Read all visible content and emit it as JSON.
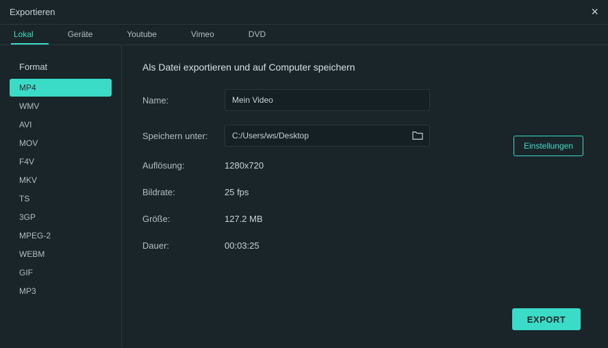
{
  "window": {
    "title": "Exportieren"
  },
  "tabs": [
    {
      "label": "Lokal",
      "active": true
    },
    {
      "label": "Geräte",
      "active": false
    },
    {
      "label": "Youtube",
      "active": false
    },
    {
      "label": "Vimeo",
      "active": false
    },
    {
      "label": "DVD",
      "active": false
    }
  ],
  "sidebar": {
    "title": "Format",
    "items": [
      {
        "label": "MP4",
        "selected": true
      },
      {
        "label": "WMV",
        "selected": false
      },
      {
        "label": "AVI",
        "selected": false
      },
      {
        "label": "MOV",
        "selected": false
      },
      {
        "label": "F4V",
        "selected": false
      },
      {
        "label": "MKV",
        "selected": false
      },
      {
        "label": "TS",
        "selected": false
      },
      {
        "label": "3GP",
        "selected": false
      },
      {
        "label": "MPEG-2",
        "selected": false
      },
      {
        "label": "WEBM",
        "selected": false
      },
      {
        "label": "GIF",
        "selected": false
      },
      {
        "label": "MP3",
        "selected": false
      }
    ]
  },
  "main": {
    "heading": "Als Datei exportieren und auf Computer speichern",
    "name_label": "Name:",
    "name_value": "Mein Video",
    "path_label": "Speichern unter:",
    "path_value": "C:/Users/ws/Desktop",
    "resolution_label": "Auflösung:",
    "resolution_value": "1280x720",
    "settings_label": "Einstellungen",
    "fps_label": "Bildrate:",
    "fps_value": "25 fps",
    "size_label": "Größe:",
    "size_value": "127.2 MB",
    "duration_label": "Dauer:",
    "duration_value": "00:03:25",
    "export_label": "EXPORT"
  }
}
